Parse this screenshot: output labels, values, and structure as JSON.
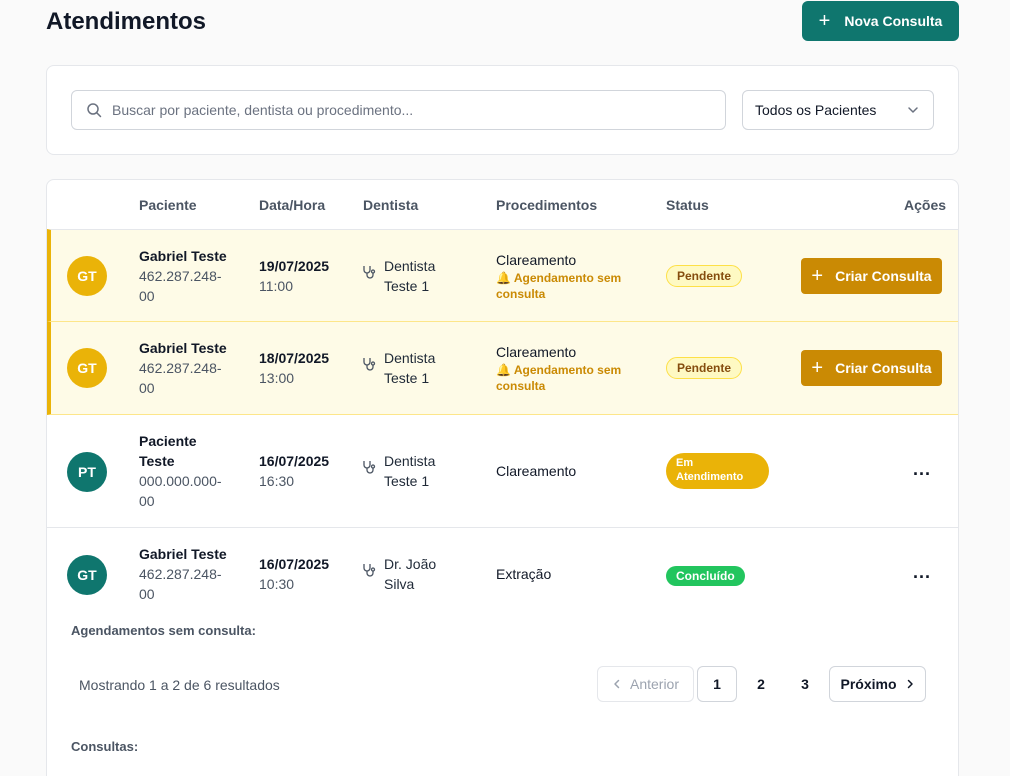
{
  "header": {
    "title": "Atendimentos",
    "new_button_label": "Nova Consulta",
    "new_button_icon": "plus-icon"
  },
  "filters": {
    "search_placeholder": "Buscar por paciente, dentista ou procedimento...",
    "search_value": "",
    "patient_filter_selected": "Todos os Pacientes"
  },
  "table": {
    "columns": [
      "Paciente",
      "Data/Hora",
      "Dentista",
      "Procedimentos",
      "Status",
      "Ações"
    ],
    "rows": [
      {
        "initials": "GT",
        "name": "Gabriel Teste",
        "cpf_line1": "462.287.248-",
        "cpf_line2": "00",
        "date": "19/07/2025",
        "time": "11:00",
        "dentist_line1": "Dentista",
        "dentist_line2": "Teste 1",
        "procedure": "Clareamento",
        "warning_line1": "Agendamento sem",
        "warning_line2": "consulta",
        "status": "Pendente",
        "action": "Criar Consulta"
      },
      {
        "initials": "GT",
        "name": "Gabriel Teste",
        "cpf_line1": "462.287.248-",
        "cpf_line2": "00",
        "date": "18/07/2025",
        "time": "13:00",
        "dentist_line1": "Dentista",
        "dentist_line2": "Teste 1",
        "procedure": "Clareamento",
        "warning_line1": "Agendamento sem",
        "warning_line2": "consulta",
        "status": "Pendente",
        "action": "Criar Consulta"
      },
      {
        "initials": "PT",
        "name_line1": "Paciente",
        "name_line2": "Teste",
        "cpf_line1": "000.000.000-",
        "cpf_line2": "00",
        "date": "16/07/2025",
        "time": "16:30",
        "dentist_line1": "Dentista",
        "dentist_line2": "Teste 1",
        "procedure": "Clareamento",
        "status_line1": "Em",
        "status_line2": "Atendimento",
        "action": "..."
      },
      {
        "initials": "GT",
        "name": "Gabriel Teste",
        "cpf_line1": "462.287.248-",
        "cpf_line2": "00",
        "date": "16/07/2025",
        "time": "10:30",
        "dentist_line1": "Dr. João",
        "dentist_line2": "Silva",
        "procedure": "Extração",
        "status": "Concluído",
        "action": "..."
      }
    ]
  },
  "sections": {
    "unscheduled_label": "Agendamentos sem consulta:",
    "consultations_label": "Consultas:"
  },
  "pagination": {
    "results_text": "Mostrando 1 a 2 de 6 resultados",
    "prev_label": "Anterior",
    "next_label": "Próximo",
    "pages": [
      "1",
      "2",
      "3"
    ],
    "current_page": "1"
  },
  "colors": {
    "primary": "#0f766e",
    "warning": "#ca8a04",
    "pending_bg": "#fefbe7",
    "success": "#22c55e"
  }
}
